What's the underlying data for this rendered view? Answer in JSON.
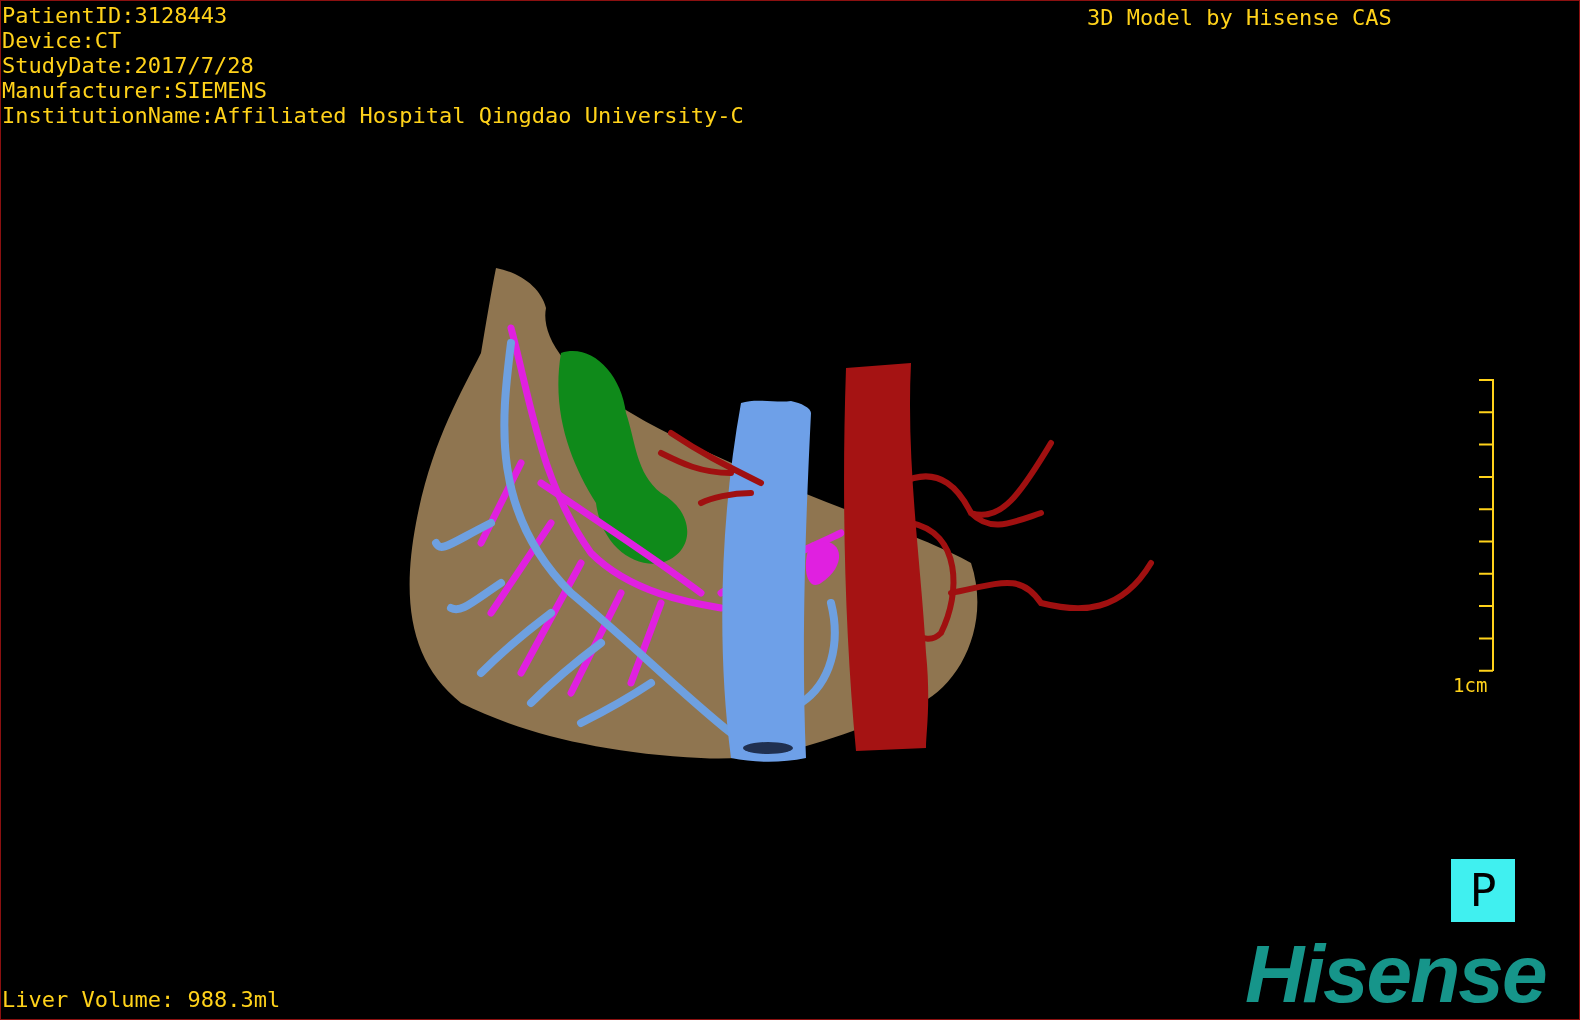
{
  "header": {
    "lines": [
      "PatientID:3128443",
      "Device:CT",
      "StudyDate:2017/7/28",
      "Manufacturer:SIEMENS",
      "InstitutionName:Affiliated Hospital Qingdao University-C"
    ],
    "title": "3D Model by Hisense CAS"
  },
  "scale": {
    "label": "1cm"
  },
  "orientation_marker": "P",
  "footer": {
    "liver_volume": "Liver Volume: 988.3ml",
    "logo": "Hisense"
  }
}
